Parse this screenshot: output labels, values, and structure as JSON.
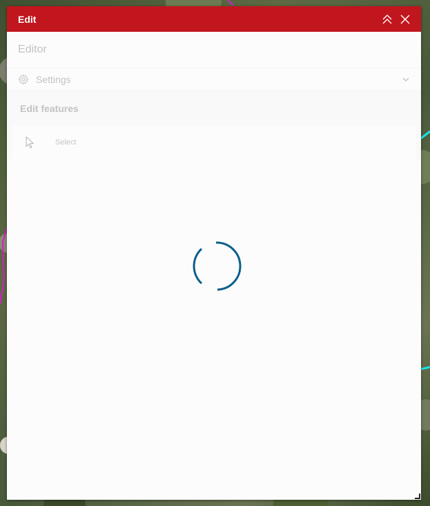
{
  "window": {
    "title": "Edit",
    "collapse_icon": "double-chevron-up-icon",
    "close_icon": "close-icon"
  },
  "editor": {
    "heading": "Editor",
    "settings": {
      "label": "Settings",
      "icon": "gear-icon",
      "expand_icon": "chevron-down-icon"
    },
    "edit_features": {
      "title": "Edit features",
      "tools": [
        {
          "label": "Select",
          "icon": "cursor-arrow-icon"
        }
      ]
    }
  },
  "loading": {
    "icon": "loading-spinner-icon"
  },
  "colors": {
    "header_bg": "#c1161e",
    "header_text": "#ffffff",
    "spinner": "#0b5e8c",
    "map_line_cyan": "#19e3ea",
    "map_line_magenta": "#d81cc9"
  }
}
